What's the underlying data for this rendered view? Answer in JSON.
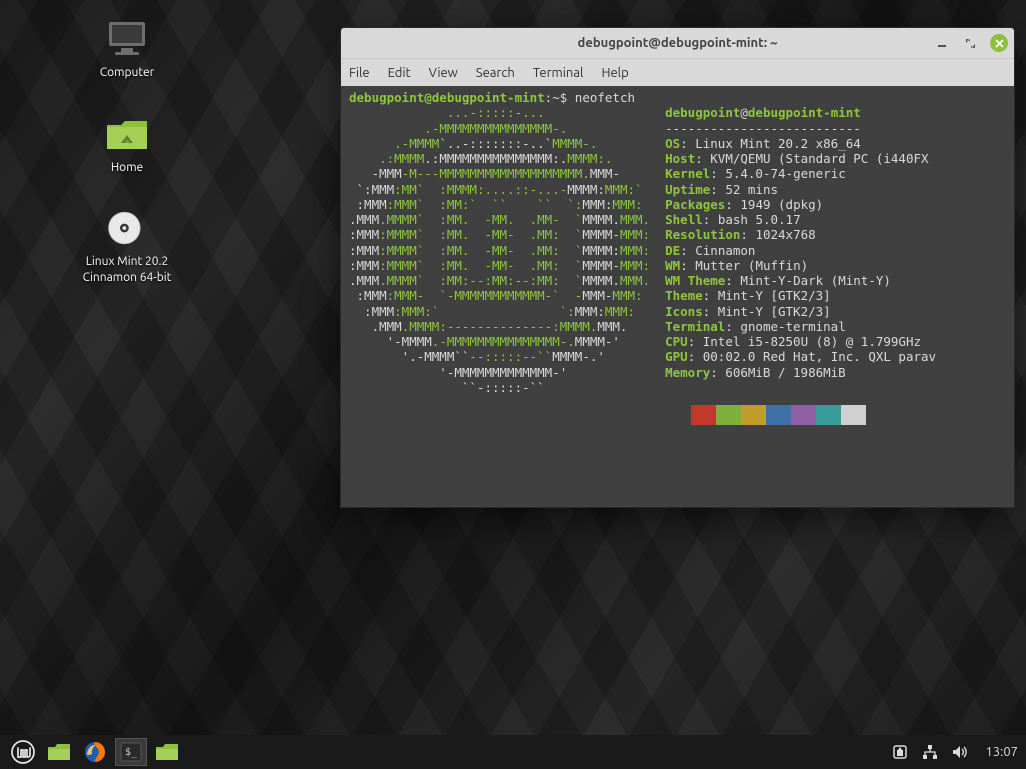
{
  "desktop": {
    "icons": [
      {
        "name": "computer",
        "label": "Computer"
      },
      {
        "name": "home",
        "label": "Home"
      },
      {
        "name": "iso",
        "label": "Linux Mint 20.2\nCinnamon 64-bit"
      }
    ]
  },
  "window": {
    "title": "debugpoint@debugpoint-mint: ~",
    "menus": [
      "File",
      "Edit",
      "View",
      "Search",
      "Terminal",
      "Help"
    ]
  },
  "prompt": {
    "user_host": "debugpoint@debugpoint-mint",
    "cwd": "~",
    "command": "neofetch"
  },
  "neofetch": {
    "header_user": "debugpoint",
    "header_host": "debugpoint-mint",
    "info": [
      {
        "label": "OS",
        "value": "Linux Mint 20.2 x86_64"
      },
      {
        "label": "Host",
        "value": "KVM/QEMU (Standard PC (i440FX"
      },
      {
        "label": "Kernel",
        "value": "5.4.0-74-generic"
      },
      {
        "label": "Uptime",
        "value": "52 mins"
      },
      {
        "label": "Packages",
        "value": "1949 (dpkg)"
      },
      {
        "label": "Shell",
        "value": "bash 5.0.17"
      },
      {
        "label": "Resolution",
        "value": "1024x768"
      },
      {
        "label": "DE",
        "value": "Cinnamon"
      },
      {
        "label": "WM",
        "value": "Mutter (Muffin)"
      },
      {
        "label": "WM Theme",
        "value": "Mint-Y-Dark (Mint-Y)"
      },
      {
        "label": "Theme",
        "value": "Mint-Y [GTK2/3]"
      },
      {
        "label": "Icons",
        "value": "Mint-Y [GTK2/3]"
      },
      {
        "label": "Terminal",
        "value": "gnome-terminal"
      },
      {
        "label": "CPU",
        "value": "Intel i5-8250U (8) @ 1.799GHz"
      },
      {
        "label": "GPU",
        "value": "00:02.0 Red Hat, Inc. QXL parav"
      },
      {
        "label": "Memory",
        "value": "606MiB / 1986MiB"
      }
    ],
    "swatch_colors": [
      "#404040",
      "#c0392b",
      "#7fb03b",
      "#c29d2e",
      "#3e6fa5",
      "#8e5fa3",
      "#3a9b9b",
      "#d0d0d0"
    ]
  },
  "panel": {
    "clock": "13:07"
  }
}
